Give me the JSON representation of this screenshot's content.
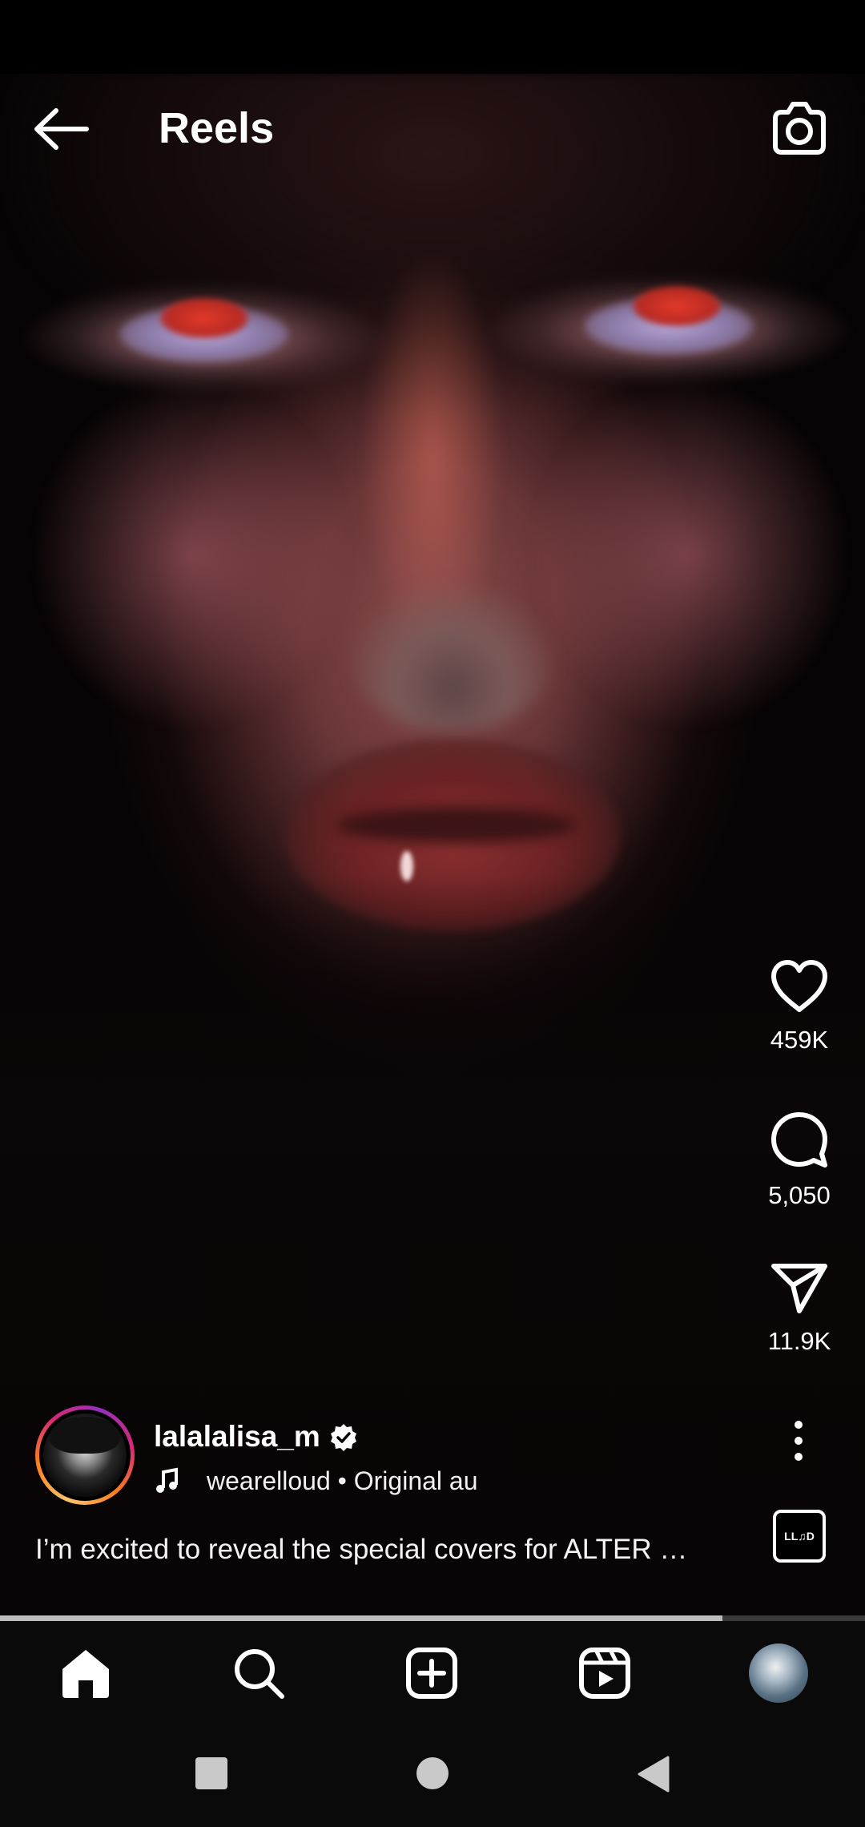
{
  "header": {
    "title": "Reels",
    "back_icon": "arrow-left-icon",
    "camera_icon": "camera-icon"
  },
  "actions": {
    "likes": "459K",
    "comments": "5,050",
    "shares": "11.9K"
  },
  "post": {
    "username": "lalalalisa_m",
    "verified": true,
    "audio": "wearelloud • Original au",
    "caption": "I’m excited to reveal the special covers for ALTER …",
    "audio_thumb_label": "LL♫D"
  },
  "playback": {
    "progress_fraction": 0.835
  },
  "bottom_nav": {
    "items": [
      "home-icon",
      "search-icon",
      "create-icon",
      "reels-icon",
      "profile-avatar"
    ],
    "active": "home-icon"
  },
  "colors": {
    "background": "#000000",
    "text": "#ffffff",
    "progress_fill": "#bdbdbd",
    "progress_track": "#3a3a3a"
  }
}
